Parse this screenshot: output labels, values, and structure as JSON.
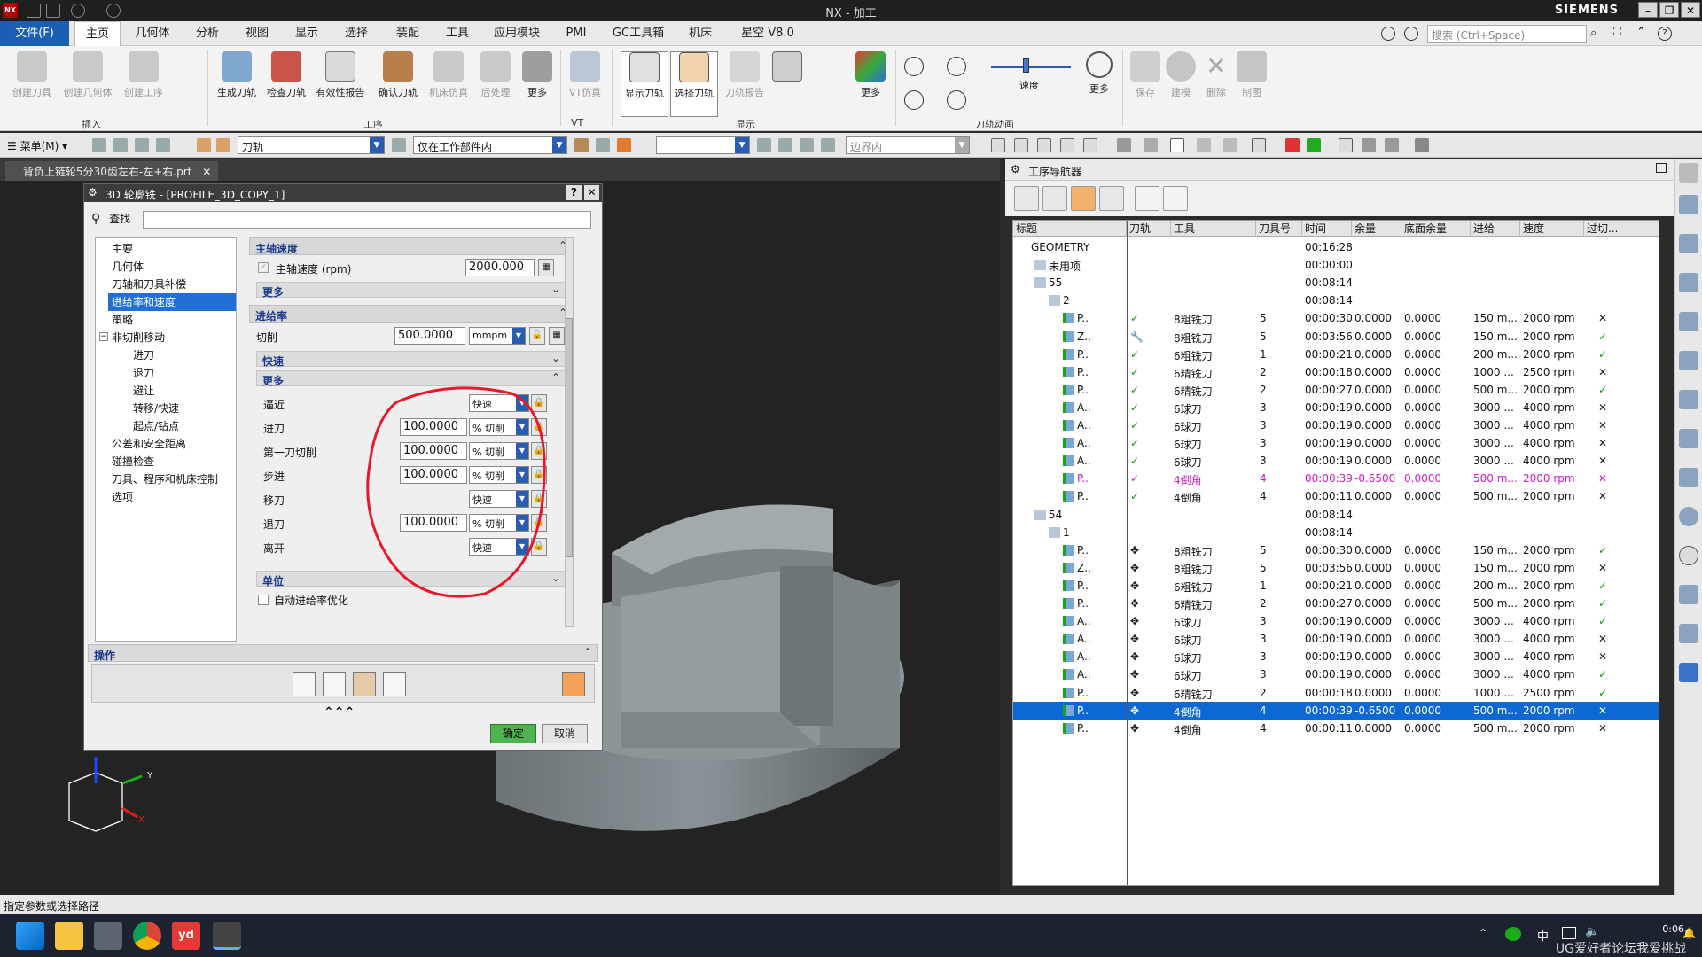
{
  "window": {
    "title": "NX - 加工",
    "brand": "SIEMENS",
    "search_placeholder": "搜索 (Ctrl+Space)"
  },
  "menu": {
    "file": "文件(F)",
    "items": [
      "主页",
      "几何体",
      "分析",
      "视图",
      "显示",
      "选择",
      "装配",
      "工具",
      "应用模块",
      "PMI",
      "GC工具箱",
      "机床",
      "星空 V8.0"
    ]
  },
  "ribbon": {
    "buttons": [
      "创建刀具",
      "创建几何体",
      "创建工序",
      "生成刀轨",
      "检查刀轨",
      "有效性报告",
      "确认刀轨",
      "机床仿真",
      "后处理",
      "更多",
      "VT仿真",
      "显示刀轨",
      "选择刀轨",
      "刀轨报告",
      "更多",
      "速度",
      "更多",
      "保存",
      "建模",
      "删除",
      "制图"
    ],
    "groups": [
      "插入",
      "工序",
      "VT",
      "显示",
      "刀轨动画"
    ]
  },
  "toolbar2": {
    "menu_label": "菜单(M)",
    "filter_value": "刀轨",
    "scope_value": "仅在工作部件内",
    "extra_value": "",
    "boundary_placeholder": "边界内"
  },
  "document": {
    "tab_label": "背负上链轮5分30齿左右-左+右.prt"
  },
  "dialog": {
    "title": "3D 轮廓铣 - [PROFILE_3D_COPY_1]",
    "find_label": "查找",
    "tree": [
      "主要",
      "几何体",
      "刀轴和刀具补偿",
      "进给率和速度",
      "策略",
      "非切削移动",
      "进刀",
      "退刀",
      "避让",
      "转移/快速",
      "起点/钻点",
      "公差和安全距离",
      "碰撞检查",
      "刀具、程序和机床控制",
      "选项"
    ],
    "spindle": {
      "header": "主轴速度",
      "label": "主轴速度 (rpm)",
      "value": "2000.000",
      "more": "更多"
    },
    "feed": {
      "header": "进给率",
      "cut_label": "切削",
      "cut_value": "500.0000",
      "cut_unit": "mmpm",
      "rapid": "快速",
      "more": "更多",
      "rows": [
        {
          "label": "逼近",
          "value": "",
          "unit": "快速"
        },
        {
          "label": "进刀",
          "value": "100.0000",
          "unit": "% 切削"
        },
        {
          "label": "第一刀切削",
          "value": "100.0000",
          "unit": "% 切削"
        },
        {
          "label": "步进",
          "value": "100.0000",
          "unit": "% 切削"
        },
        {
          "label": "移刀",
          "value": "",
          "unit": "快速"
        },
        {
          "label": "退刀",
          "value": "100.0000",
          "unit": "% 切削"
        },
        {
          "label": "离开",
          "value": "",
          "unit": "快速"
        }
      ],
      "units_header": "单位",
      "auto_opt": "自动进给率优化"
    },
    "ops_header": "操作",
    "ok": "确定",
    "cancel": "取消"
  },
  "navigator": {
    "title": "工序导航器",
    "columns": [
      "标题",
      "刀轨",
      "工具",
      "刀具号",
      "时间",
      "余量",
      "底面余量",
      "进给",
      "速度",
      "过切..."
    ],
    "rows": [
      {
        "name": "GEOMETRY",
        "path": "",
        "tool": "",
        "num": "",
        "time": "00:16:28",
        "stock": "",
        "floor": "",
        "feed": "",
        "speed": "",
        "gouge": "",
        "indent": 0,
        "style": ""
      },
      {
        "name": "未用项",
        "path": "",
        "tool": "",
        "num": "",
        "time": "00:00:00",
        "stock": "",
        "floor": "",
        "feed": "",
        "speed": "",
        "gouge": "",
        "indent": 1,
        "style": ""
      },
      {
        "name": "55",
        "path": "",
        "tool": "",
        "num": "",
        "time": "00:08:14",
        "stock": "",
        "floor": "",
        "feed": "",
        "speed": "",
        "gouge": "",
        "indent": 1,
        "style": ""
      },
      {
        "name": "2",
        "path": "",
        "tool": "",
        "num": "",
        "time": "00:08:14",
        "stock": "",
        "floor": "",
        "feed": "",
        "speed": "",
        "gouge": "",
        "indent": 2,
        "style": ""
      },
      {
        "name": "P..",
        "path": "✓",
        "tool": "8粗铣刀",
        "num": "5",
        "time": "00:00:30",
        "stock": "0.0000",
        "floor": "0.0000",
        "feed": "150 m...",
        "speed": "2000 rpm",
        "gouge": "✕",
        "indent": 3,
        "style": ""
      },
      {
        "name": "Z..",
        "path": "🔧",
        "tool": "8粗铣刀",
        "num": "5",
        "time": "00:03:56",
        "stock": "0.0000",
        "floor": "0.0000",
        "feed": "150 m...",
        "speed": "2000 rpm",
        "gouge": "✓",
        "indent": 3,
        "style": ""
      },
      {
        "name": "P..",
        "path": "✓",
        "tool": "6粗铣刀",
        "num": "1",
        "time": "00:00:21",
        "stock": "0.0000",
        "floor": "0.0000",
        "feed": "200 m...",
        "speed": "2000 rpm",
        "gouge": "✓",
        "indent": 3,
        "style": ""
      },
      {
        "name": "P..",
        "path": "✓",
        "tool": "6精铣刀",
        "num": "2",
        "time": "00:00:18",
        "stock": "0.0000",
        "floor": "0.0000",
        "feed": "1000 ...",
        "speed": "2500 rpm",
        "gouge": "✕",
        "indent": 3,
        "style": ""
      },
      {
        "name": "P..",
        "path": "✓",
        "tool": "6精铣刀",
        "num": "2",
        "time": "00:00:27",
        "stock": "0.0000",
        "floor": "0.0000",
        "feed": "500 m...",
        "speed": "2000 rpm",
        "gouge": "✓",
        "indent": 3,
        "style": ""
      },
      {
        "name": "A..",
        "path": "✓",
        "tool": "6球刀",
        "num": "3",
        "time": "00:00:19",
        "stock": "0.0000",
        "floor": "0.0000",
        "feed": "3000 ...",
        "speed": "4000 rpm",
        "gouge": "✕",
        "indent": 3,
        "style": ""
      },
      {
        "name": "A..",
        "path": "✓",
        "tool": "6球刀",
        "num": "3",
        "time": "00:00:19",
        "stock": "0.0000",
        "floor": "0.0000",
        "feed": "3000 ...",
        "speed": "4000 rpm",
        "gouge": "✕",
        "indent": 3,
        "style": ""
      },
      {
        "name": "A..",
        "path": "✓",
        "tool": "6球刀",
        "num": "3",
        "time": "00:00:19",
        "stock": "0.0000",
        "floor": "0.0000",
        "feed": "3000 ...",
        "speed": "4000 rpm",
        "gouge": "✕",
        "indent": 3,
        "style": ""
      },
      {
        "name": "A..",
        "path": "✓",
        "tool": "6球刀",
        "num": "3",
        "time": "00:00:19",
        "stock": "0.0000",
        "floor": "0.0000",
        "feed": "3000 ...",
        "speed": "4000 rpm",
        "gouge": "✕",
        "indent": 3,
        "style": ""
      },
      {
        "name": "P..",
        "path": "✓",
        "tool": "4倒角",
        "num": "4",
        "time": "00:00:39",
        "stock": "-0.6500",
        "floor": "0.0000",
        "feed": "500 m...",
        "speed": "2000 rpm",
        "gouge": "✕",
        "indent": 3,
        "style": "magenta"
      },
      {
        "name": "P..",
        "path": "✓",
        "tool": "4倒角",
        "num": "4",
        "time": "00:00:11",
        "stock": "0.0000",
        "floor": "0.0000",
        "feed": "500 m...",
        "speed": "2000 rpm",
        "gouge": "✕",
        "indent": 3,
        "style": ""
      },
      {
        "name": "54",
        "path": "",
        "tool": "",
        "num": "",
        "time": "00:08:14",
        "stock": "",
        "floor": "",
        "feed": "",
        "speed": "",
        "gouge": "",
        "indent": 1,
        "style": ""
      },
      {
        "name": "1",
        "path": "",
        "tool": "",
        "num": "",
        "time": "00:08:14",
        "stock": "",
        "floor": "",
        "feed": "",
        "speed": "",
        "gouge": "",
        "indent": 2,
        "style": ""
      },
      {
        "name": "P..",
        "path": "✥",
        "tool": "8粗铣刀",
        "num": "5",
        "time": "00:00:30",
        "stock": "0.0000",
        "floor": "0.0000",
        "feed": "150 m...",
        "speed": "2000 rpm",
        "gouge": "✓",
        "indent": 3,
        "style": ""
      },
      {
        "name": "Z..",
        "path": "✥",
        "tool": "8粗铣刀",
        "num": "5",
        "time": "00:03:56",
        "stock": "0.0000",
        "floor": "0.0000",
        "feed": "150 m...",
        "speed": "2000 rpm",
        "gouge": "✕",
        "indent": 3,
        "style": ""
      },
      {
        "name": "P..",
        "path": "✥",
        "tool": "6粗铣刀",
        "num": "1",
        "time": "00:00:21",
        "stock": "0.0000",
        "floor": "0.0000",
        "feed": "200 m...",
        "speed": "2000 rpm",
        "gouge": "✓",
        "indent": 3,
        "style": ""
      },
      {
        "name": "P..",
        "path": "✥",
        "tool": "6精铣刀",
        "num": "2",
        "time": "00:00:27",
        "stock": "0.0000",
        "floor": "0.0000",
        "feed": "500 m...",
        "speed": "2000 rpm",
        "gouge": "✓",
        "indent": 3,
        "style": ""
      },
      {
        "name": "A..",
        "path": "✥",
        "tool": "6球刀",
        "num": "3",
        "time": "00:00:19",
        "stock": "0.0000",
        "floor": "0.0000",
        "feed": "3000 ...",
        "speed": "4000 rpm",
        "gouge": "✓",
        "indent": 3,
        "style": ""
      },
      {
        "name": "A..",
        "path": "✥",
        "tool": "6球刀",
        "num": "3",
        "time": "00:00:19",
        "stock": "0.0000",
        "floor": "0.0000",
        "feed": "3000 ...",
        "speed": "4000 rpm",
        "gouge": "✕",
        "indent": 3,
        "style": ""
      },
      {
        "name": "A..",
        "path": "✥",
        "tool": "6球刀",
        "num": "3",
        "time": "00:00:19",
        "stock": "0.0000",
        "floor": "0.0000",
        "feed": "3000 ...",
        "speed": "4000 rpm",
        "gouge": "✕",
        "indent": 3,
        "style": ""
      },
      {
        "name": "A..",
        "path": "✥",
        "tool": "6球刀",
        "num": "3",
        "time": "00:00:19",
        "stock": "0.0000",
        "floor": "0.0000",
        "feed": "3000 ...",
        "speed": "4000 rpm",
        "gouge": "✓",
        "indent": 3,
        "style": ""
      },
      {
        "name": "P..",
        "path": "✥",
        "tool": "6精铣刀",
        "num": "2",
        "time": "00:00:18",
        "stock": "0.0000",
        "floor": "0.0000",
        "feed": "1000 ...",
        "speed": "2500 rpm",
        "gouge": "✓",
        "indent": 3,
        "style": ""
      },
      {
        "name": "P..",
        "path": "✥",
        "tool": "4倒角",
        "num": "4",
        "time": "00:00:39",
        "stock": "-0.6500",
        "floor": "0.0000",
        "feed": "500 m...",
        "speed": "2000 rpm",
        "gouge": "✕",
        "indent": 3,
        "style": "selected"
      },
      {
        "name": "P..",
        "path": "✥",
        "tool": "4倒角",
        "num": "4",
        "time": "00:00:11",
        "stock": "0.0000",
        "floor": "0.0000",
        "feed": "500 m...",
        "speed": "2000 rpm",
        "gouge": "✕",
        "indent": 3,
        "style": ""
      }
    ]
  },
  "status": {
    "message": "指定参数或选择路径"
  },
  "taskbar": {
    "time": "0:06",
    "ime": "中",
    "watermark": "UG爱好者论坛我爱挑战"
  },
  "colors": {
    "accent": "#1a5fb4",
    "selection": "#0d68d3",
    "ok_green": "#4fb34f",
    "highlight_magenta": "#d119c8",
    "annotation_red": "#e8182a"
  }
}
